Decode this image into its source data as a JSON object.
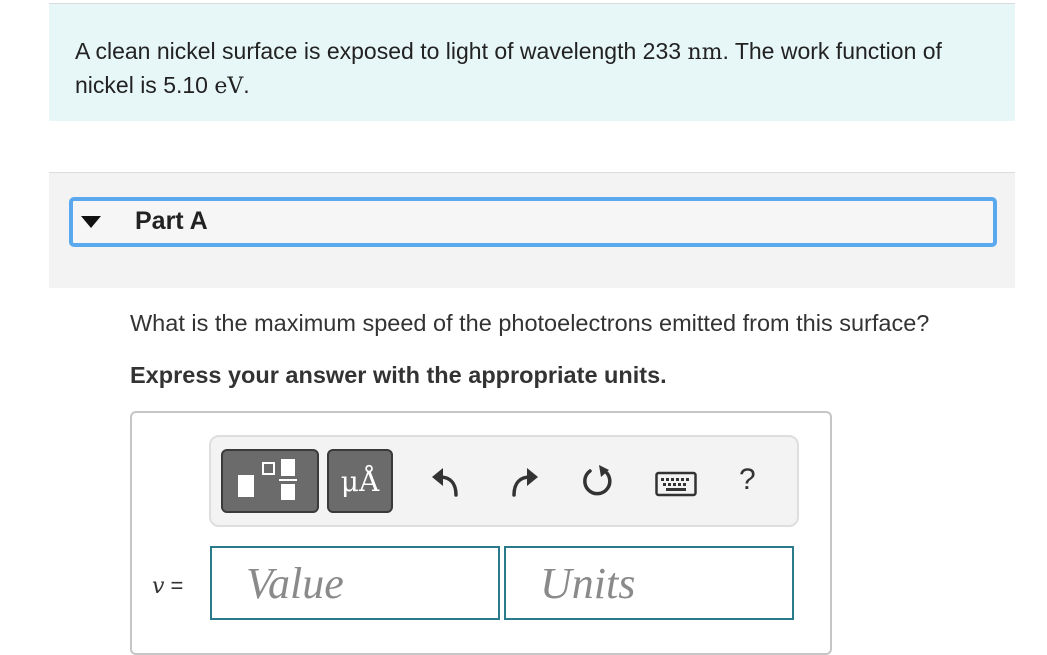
{
  "problem": {
    "text_before": "A clean nickel surface is exposed to light of wavelength 233 ",
    "wavelength_unit": "nm",
    "text_middle": ". The work function of nickel is 5.10 ",
    "work_function_unit": "eV",
    "text_after": "."
  },
  "part": {
    "title": "Part A",
    "question": "What is the maximum speed of the photoelectrons emitted from this surface?",
    "instruction": "Express your answer with the appropriate units."
  },
  "toolbar": {
    "units_button_label": "μÅ",
    "help_label": "?"
  },
  "answer": {
    "variable": "v",
    "equals": " =",
    "value_placeholder": "Value",
    "units_placeholder": "Units",
    "value": "",
    "units": ""
  },
  "colors": {
    "problem_bg": "#e7f6f7",
    "part_header_border": "#5aa9ee",
    "input_border": "#2a7a8c",
    "toolbar_button": "#6b6b6b"
  }
}
